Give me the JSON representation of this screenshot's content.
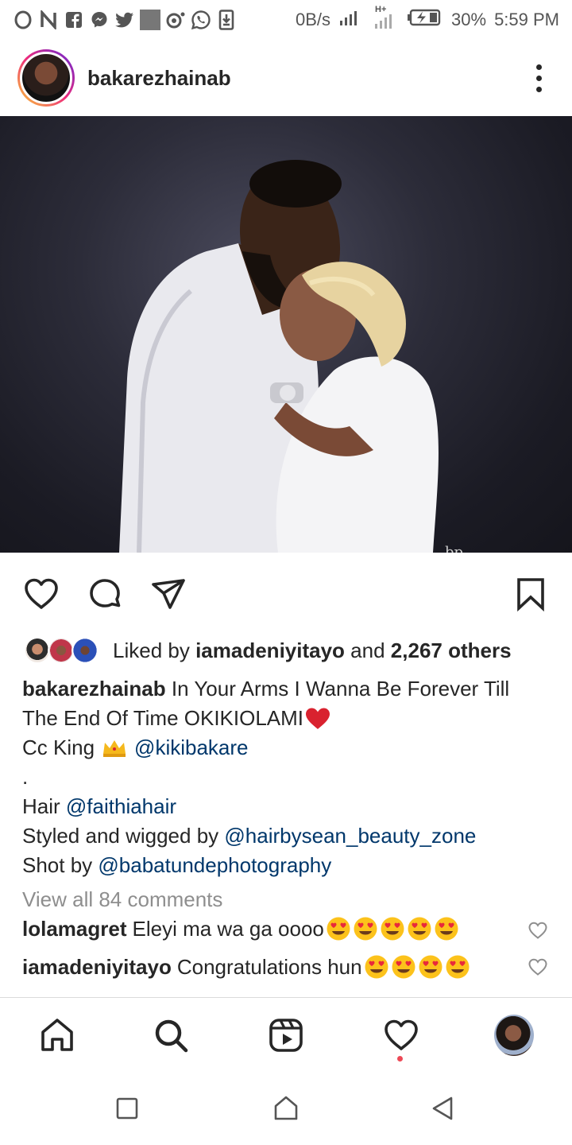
{
  "status_bar": {
    "net_speed": "0B/s",
    "battery_percent": "30%",
    "time": "5:59 PM",
    "network_type": "H+",
    "left_icons": [
      "opera-icon",
      "n-icon",
      "facebook-icon",
      "messenger-icon",
      "twitter-icon",
      "gray-square-icon",
      "record-icon",
      "whatsapp-icon",
      "download-icon"
    ]
  },
  "post": {
    "username": "bakarezhainab",
    "photo_watermark": "bp"
  },
  "likes": {
    "prefix": "Liked by",
    "first_liker": "iamadeniyitayo",
    "connector": "and",
    "others": "2,267 others"
  },
  "caption": {
    "author": "bakarezhainab",
    "line1_text": "In Your Arms I Wanna Be Forever Till",
    "line2_text": "The End Of Time OKIKIOLAMI",
    "line3_prefix": "Cc King",
    "line3_mention": "@kikibakare",
    "line4": ".",
    "line5_prefix": "Hair",
    "line5_mention": "@faithiahair",
    "line6_prefix": "Styled and wigged by",
    "line6_mention": "@hairbysean_beauty_zone",
    "line7_prefix": "Shot by",
    "line7_mention": "@babatundephotography"
  },
  "view_all_comments": "View all 84 comments",
  "comments": [
    {
      "username": "lolamagret",
      "text": "Eleyi ma wa ga oooo",
      "emoji_count": 5
    },
    {
      "username": "iamadeniyitayo",
      "text": "Congratulations hun",
      "emoji_count": 4
    }
  ],
  "bottom_nav": [
    "home-icon",
    "search-icon",
    "reels-icon",
    "activity-heart-icon",
    "profile-avatar"
  ],
  "colors": {
    "mention": "#00376b",
    "muted": "#8e8e8e",
    "notification_dot": "#ed4956",
    "text": "#262626"
  }
}
